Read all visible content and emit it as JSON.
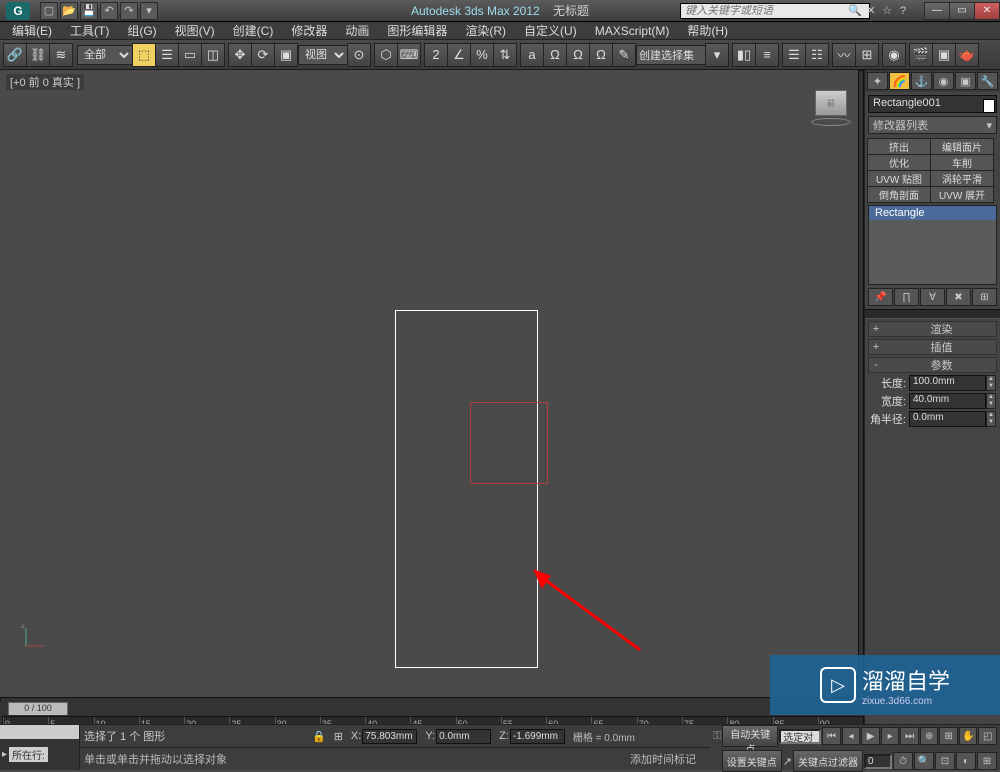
{
  "title": {
    "app": "Autodesk 3ds Max 2012",
    "doc": "无标题"
  },
  "search_placeholder": "键入关键字或短语",
  "menus": [
    "编辑(E)",
    "工具(T)",
    "组(G)",
    "视图(V)",
    "创建(C)",
    "修改器",
    "动画",
    "图形编辑器",
    "渲染(R)",
    "自定义(U)",
    "MAXScript(M)",
    "帮助(H)"
  ],
  "toolbar": {
    "filter_all": "全部",
    "view_dropdown": "视图",
    "named_set": "创建选择集"
  },
  "viewport": {
    "label": "[+0 前 0 真实 ]",
    "cube_face": "前"
  },
  "timeline": {
    "slider": "0 / 100",
    "ticks": [
      "0",
      "5",
      "10",
      "15",
      "20",
      "25",
      "30",
      "35",
      "40",
      "45",
      "50",
      "55",
      "60",
      "65",
      "70",
      "75",
      "80",
      "85",
      "90"
    ]
  },
  "command_panel": {
    "object_name": "Rectangle001",
    "modifier_list": "修改器列表",
    "mod_buttons": [
      "挤出",
      "编辑面片",
      "优化",
      "车削",
      "UVW 贴图",
      "涡轮平滑",
      "倒角剖面",
      "UVW 展开"
    ],
    "stack_item": "Rectangle",
    "rollouts": {
      "render": "渲染",
      "interp": "插值",
      "params": "参数"
    },
    "params": {
      "length_label": "长度:",
      "length_value": "100.0mm",
      "width_label": "宽度:",
      "width_value": "40.0mm",
      "corner_label": "角半径:",
      "corner_value": "0.0mm"
    }
  },
  "status": {
    "row_label": "所在行:",
    "selection_info": "选择了 1 个 图形",
    "prompt": "单击或单击并拖动以选择对象",
    "x_label": "X:",
    "x": "75.803mm",
    "y_label": "Y:",
    "y": "0.0mm",
    "z_label": "Z:",
    "z": "-1.699mm",
    "grid": "栅格 = 0.0mm",
    "autokey": "自动关键点",
    "selected": "选定对",
    "setkey": "设置关键点",
    "keyfilter": "关键点过滤器",
    "addtime": "添加时间标记"
  },
  "watermark": {
    "text": "溜溜自学",
    "sub": "zixue.3d66.com"
  }
}
